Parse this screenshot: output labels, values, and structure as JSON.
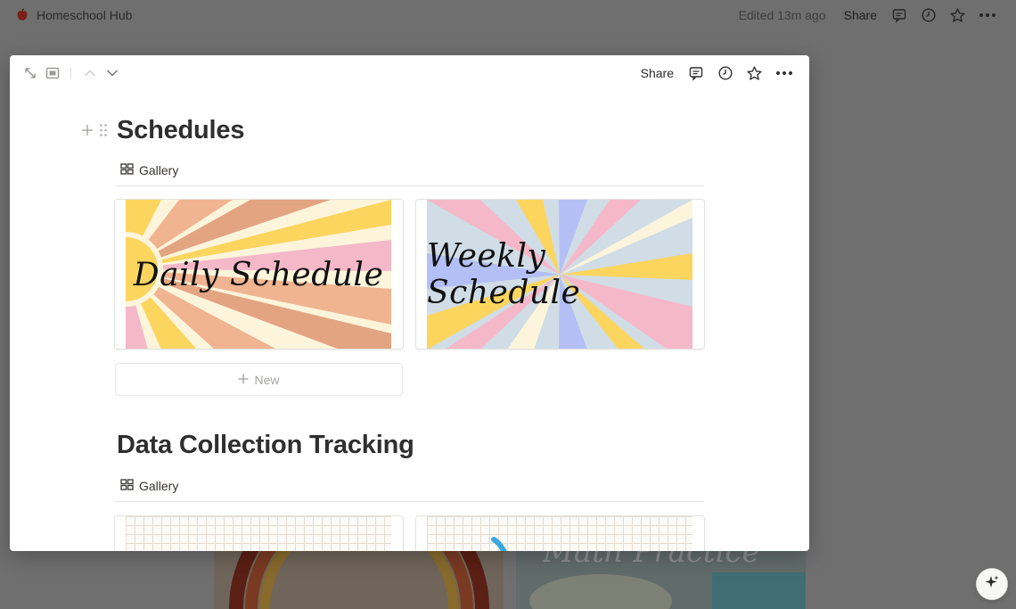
{
  "app": {
    "title": "Homeschool Hub",
    "logo_icon": "apple-icon"
  },
  "topbar": {
    "edited": "Edited 13m ago",
    "share_label": "Share",
    "icons": [
      "comment-icon",
      "history-icon",
      "star-icon",
      "more-icon"
    ]
  },
  "modal": {
    "header": {
      "left_icons": [
        "expand-icon",
        "side-peek-icon",
        "chevron-up-icon",
        "chevron-down-icon"
      ],
      "share_label": "Share",
      "right_icons": [
        "comment-icon",
        "history-icon",
        "star-icon",
        "more-icon"
      ]
    },
    "sections": [
      {
        "title": "Schedules",
        "view_label": "Gallery",
        "cards": [
          {
            "cover_text": "Daily Schedule"
          },
          {
            "cover_text": "Weekly Schedule"
          }
        ],
        "new_label": "New"
      },
      {
        "title": "Data Collection Tracking",
        "view_label": "Gallery"
      }
    ]
  },
  "colors": {
    "overlay": "#6f6f6f",
    "peach": "#f0b491",
    "yellow": "#fbd55e",
    "pink": "#f5b8c9",
    "cream": "#fdf4dc",
    "lavender": "#b3bff5",
    "blue_grey": "#d0dde6"
  }
}
